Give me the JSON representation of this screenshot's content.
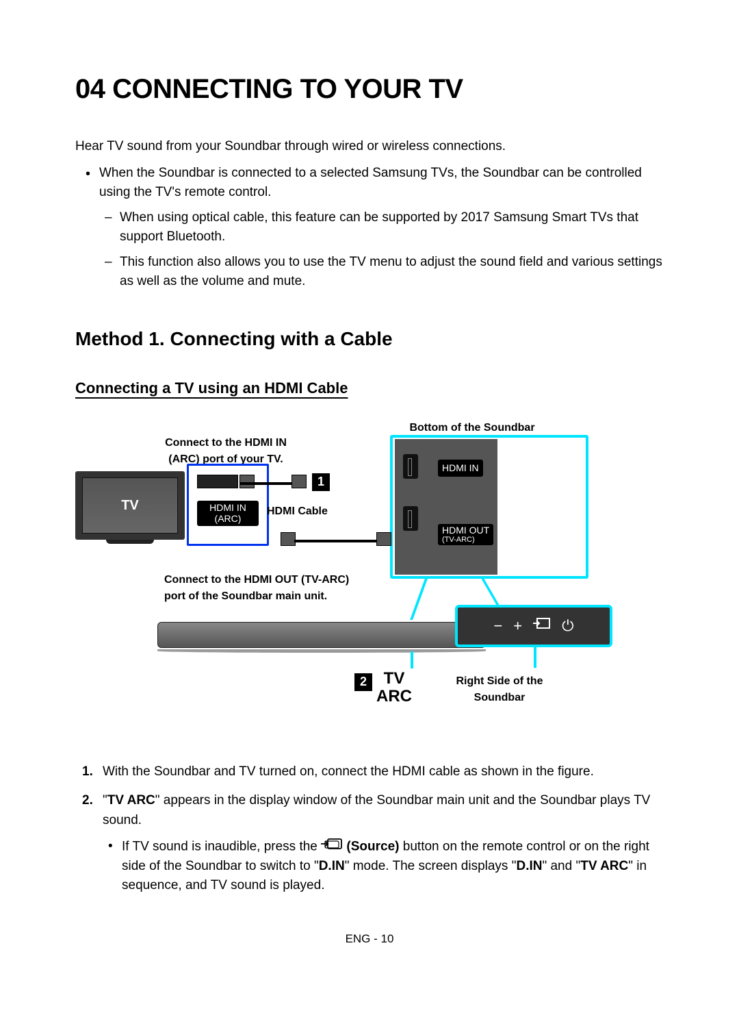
{
  "title": "04   CONNECTING TO YOUR TV",
  "intro": "Hear TV sound from your Soundbar through wired or wireless connections.",
  "bullet1": "When the Soundbar is connected to a selected Samsung TVs, the Soundbar can be controlled using the TV's remote control.",
  "dash1": "When using optical cable, this feature can be supported by 2017 Samsung Smart TVs that support Bluetooth.",
  "dash2": "This function also allows you to use the TV menu to adjust the sound field and various settings as well as the volume and mute.",
  "method_heading": "Method 1. Connecting with a Cable",
  "sub_heading": "Connecting a TV using an HDMI Cable",
  "diagram": {
    "bottom_label": "Bottom of the Soundbar",
    "connect_tv_line1": "Connect to the HDMI IN",
    "connect_tv_line2": "(ARC) port of your TV.",
    "tv_label": "TV",
    "hdmi_in_arc_line1": "HDMI IN",
    "hdmi_in_arc_line2": "(ARC)",
    "hdmi_cable": "HDMI Cable",
    "hdmi_in": "HDMI IN",
    "hdmi_out_line1": "HDMI OUT",
    "hdmi_out_line2": "(TV-ARC)",
    "connect_sb_line1": "Connect to the HDMI OUT (TV-ARC)",
    "connect_sb_line2": "port of the Soundbar main unit.",
    "right_side_line1": "Right Side of the",
    "right_side_line2": "Soundbar",
    "tv_arc_line1": "TV",
    "tv_arc_line2": "ARC",
    "num1": "1",
    "num2": "2",
    "minus": "−",
    "plus": "+",
    "power": "⏻"
  },
  "step1": "With the Soundbar and TV turned on, connect the HDMI cable as shown in the figure.",
  "step2_a": "\"",
  "step2_b": "TV ARC",
  "step2_c": "\" appears in the display window of the Soundbar main unit and the Soundbar plays TV sound.",
  "step2_sub_a": "If TV sound is inaudible, press the ",
  "step2_sub_b": " (Source)",
  "step2_sub_c": " button on the remote control or on the right side of the Soundbar to switch to \"",
  "step2_sub_d": "D.IN",
  "step2_sub_e": "\" mode. The screen displays \"",
  "step2_sub_f": "D.IN",
  "step2_sub_g": "\" and \"",
  "step2_sub_h": "TV ARC",
  "step2_sub_i": "\" in sequence, and TV sound is played.",
  "footer": "ENG - 10"
}
